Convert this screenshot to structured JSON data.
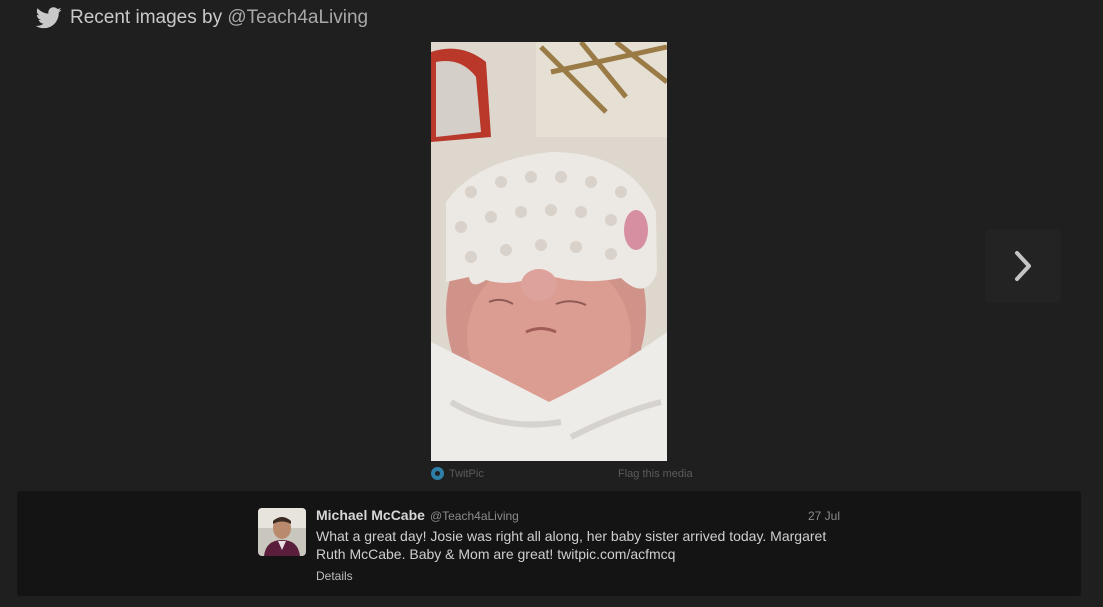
{
  "header": {
    "title_prefix": "Recent images by ",
    "handle": "@Teach4aLiving"
  },
  "media": {
    "source_label": "TwitPic",
    "flag_label": "Flag this media"
  },
  "tweet": {
    "name": "Michael McCabe",
    "screen_name": "@Teach4aLiving",
    "time": "27 Jul",
    "text": "What a great day! Josie was right all along, her baby sister arrived today. Margaret Ruth McCabe. Baby & Mom are great! twitpic.com/acfmcq",
    "details_label": "Details"
  },
  "colors": {
    "background": "#1f1f1f",
    "panel": "#141414",
    "twitpic_blue": "#2e7fa8"
  },
  "icons": {
    "header": "twitter-bird-icon",
    "next": "chevron-right-icon",
    "source": "twitpic-icon"
  }
}
